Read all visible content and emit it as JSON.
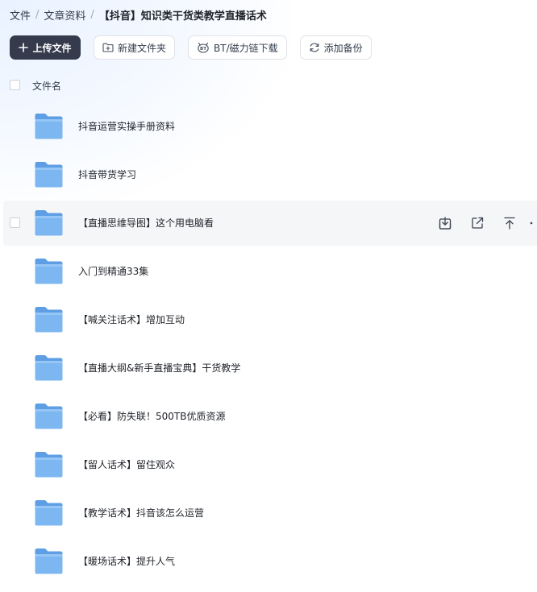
{
  "breadcrumb": {
    "items": [
      "文件",
      "文章资料"
    ],
    "separator": "/",
    "current": "【抖音】知识类干货类教学直播话术"
  },
  "toolbar": {
    "upload_label": "上传文件",
    "new_folder_label": "新建文件夹",
    "bt_label": "BT/磁力链下载",
    "backup_label": "添加备份"
  },
  "list": {
    "column_name": "文件名",
    "items": [
      {
        "name": "抖音运营实操手册资料"
      },
      {
        "name": "抖音带货学习"
      },
      {
        "name": "【直播思维导图】这个用电脑看"
      },
      {
        "name": "入门到精通33集"
      },
      {
        "name": "【喊关注话术】增加互动"
      },
      {
        "name": "【直播大纲&新手直播宝典】干货教学"
      },
      {
        "name": "【必看】防失联！500TB优质资源"
      },
      {
        "name": "【留人话术】留住观众"
      },
      {
        "name": "【教学话术】抖音该怎么运营"
      },
      {
        "name": "【暖场话术】提升人气"
      }
    ]
  },
  "colors": {
    "primary_button": "#353b4c",
    "folder_front": "#7cb7f1",
    "folder_back": "#5d9ee4",
    "row_hover": "#f5f6f8"
  },
  "icons": [
    "plus-icon",
    "new-folder-icon",
    "bt-icon",
    "backup-sync-icon",
    "folder-icon",
    "download-icon",
    "share-icon",
    "move-top-icon",
    "more-icon"
  ]
}
